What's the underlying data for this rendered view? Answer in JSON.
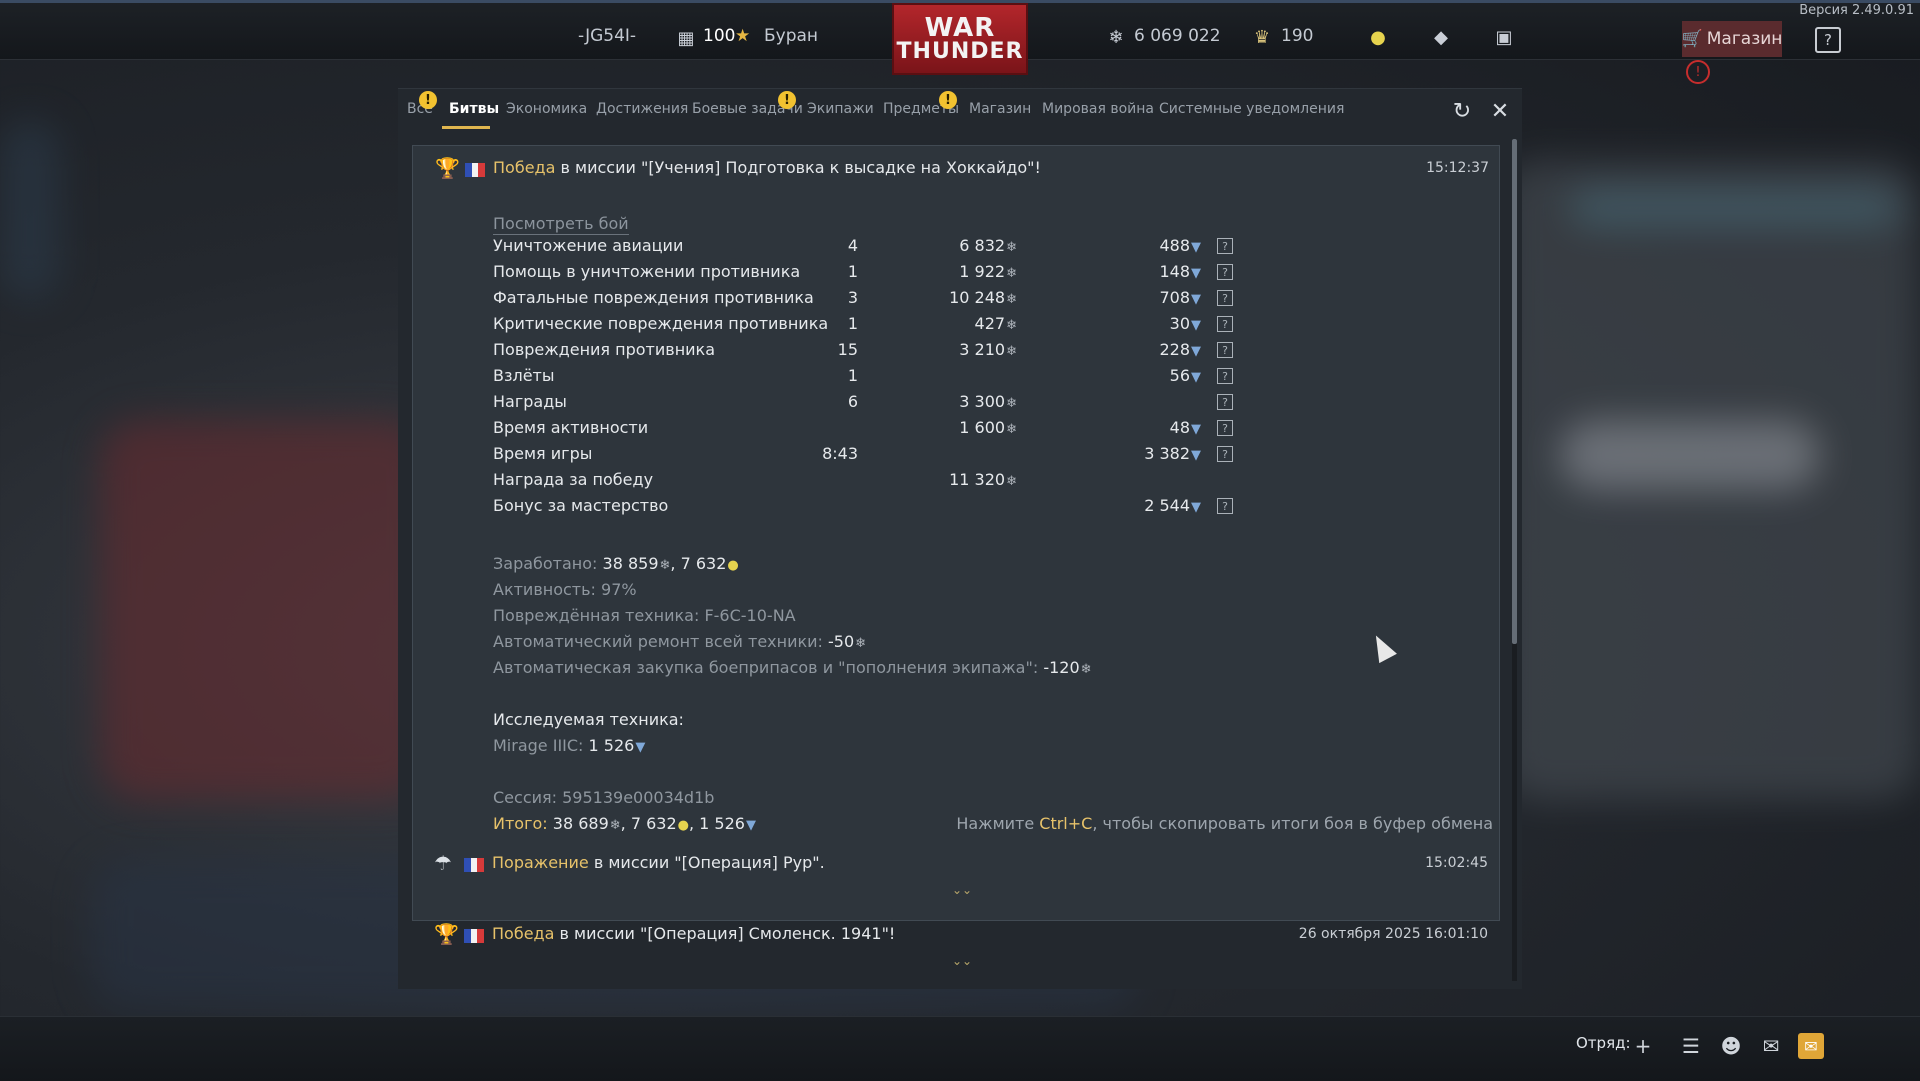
{
  "version": "Версия 2.49.0.91",
  "topbar": {
    "player_name": "-JG54I-",
    "level": "100",
    "squadron": "Буран",
    "logo_line1": "WAR",
    "logo_line2": "THUNDER",
    "silver_lions": "6 069 022",
    "golden_eagles": "190",
    "shop_label": "Магазин",
    "help_label": "?"
  },
  "tabs": [
    {
      "label": "Все",
      "warning": true
    },
    {
      "label": "Битвы",
      "active": true
    },
    {
      "label": "Экономика"
    },
    {
      "label": "Достижения"
    },
    {
      "label": "Боевые задачи",
      "warning": true
    },
    {
      "label": "Экипажи"
    },
    {
      "label": "Предметы",
      "warning": true
    },
    {
      "label": "Магазин"
    },
    {
      "label": "Мировая война"
    },
    {
      "label": "Системные уведомления"
    }
  ],
  "entries": [
    {
      "result": "Победа",
      "mission": " в миссии \"[Учения] Подготовка к высадке на Хоккайдо\"!",
      "time": "15:12:37",
      "view_battle": "Посмотреть бой",
      "stats": [
        {
          "label": "Уничтожение авиации",
          "count": "4",
          "sl": "6 832",
          "rp": "488"
        },
        {
          "label": "Помощь в уничтожении противника",
          "count": "1",
          "sl": "1 922",
          "rp": "148"
        },
        {
          "label": "Фатальные повреждения противника",
          "count": "3",
          "sl": "10 248",
          "rp": "708"
        },
        {
          "label": "Критические повреждения противника",
          "count": "1",
          "sl": "427",
          "rp": "30"
        },
        {
          "label": "Повреждения противника",
          "count": "15",
          "sl": "3 210",
          "rp": "228"
        },
        {
          "label": "Взлёты",
          "count": "1",
          "sl": "",
          "rp": "56"
        },
        {
          "label": "Награды",
          "count": "6",
          "sl": "3 300",
          "rp": ""
        },
        {
          "label": "Время активности",
          "count": "",
          "sl": "1 600",
          "rp": "48"
        },
        {
          "label": "Время игры",
          "count": "8:43",
          "sl": "",
          "rp": "3 382"
        },
        {
          "label": "Награда за победу",
          "count": "",
          "sl": "11 320",
          "rp": ""
        },
        {
          "label": "Бонус за мастерство",
          "count": "",
          "sl": "",
          "rp": "2 544"
        }
      ],
      "earned_label": "Заработано: ",
      "earned_sl": "38 859",
      "earned_cv": "7 632",
      "activity": "Активность: 97%",
      "damaged_label": "Повреждённая техника: ",
      "damaged_value": "F-6C-10-NA",
      "repair_label": "Автоматический ремонт всей техники: ",
      "repair_value": "-50",
      "ammo_label": "Автоматическая закупка боеприпасов и \"пополнения экипажа\": ",
      "ammo_value": "-120",
      "research_title": "Исследуемая техника:",
      "research_vehicle": "Mirage IIIC: ",
      "research_rp": "1 526",
      "session": "Сессия: 595139e00034d1b",
      "total_label": "Итого:",
      "total_sl": "38 689",
      "total_cv": "7 632",
      "total_rp": "1 526",
      "copy_hint_pre": "Нажмите ",
      "copy_hint_key": "Ctrl+C",
      "copy_hint_post": ", чтобы скопировать итоги боя в буфер обмена"
    },
    {
      "result": "Поражение",
      "mission": " в миссии \"[Операция] Рур\".",
      "time": "15:02:45"
    },
    {
      "result": "Победа",
      "mission": " в миссии \"[Операция] Смоленск. 1941\"!",
      "time": "26 октября 2025 16:01:10"
    }
  ],
  "bottombar": {
    "squad_label": "Отряд:"
  },
  "colors": {
    "accent": "#e7c26a",
    "warning": "#f2c230",
    "shop": "#5a2b2e",
    "mail": "#e0a637"
  }
}
